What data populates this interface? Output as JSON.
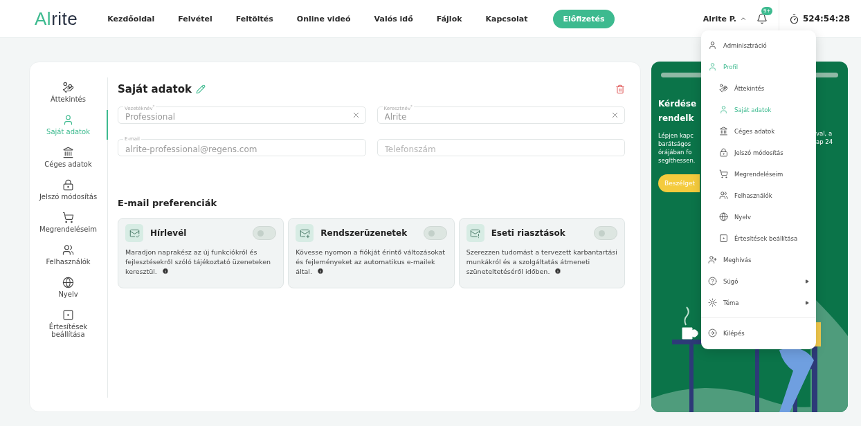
{
  "header": {
    "logo": {
      "accent": "Al",
      "rest": "rite"
    },
    "nav": [
      {
        "label": "Kezdőoldal"
      },
      {
        "label": "Felvétel"
      },
      {
        "label": "Feltöltés"
      },
      {
        "label": "Online videó"
      },
      {
        "label": "Valós idő"
      },
      {
        "label": "Fájlok"
      },
      {
        "label": "Kapcsolat"
      }
    ],
    "subscribe_button": "Előfizetés",
    "user": "Alrite P.",
    "menu_open": true,
    "notification_badge": "9+",
    "timer": "524:54:28"
  },
  "sidebar": {
    "items": [
      {
        "label": "Áttekintés",
        "selected": false
      },
      {
        "label": "Saját adatok",
        "selected": true
      },
      {
        "label": "Céges adatok",
        "selected": false
      },
      {
        "label": "Jelszó módosítás",
        "selected": false
      },
      {
        "label": "Megrendeléseim",
        "selected": false
      },
      {
        "label": "Felhasználók",
        "selected": false
      },
      {
        "label": "Nyelv",
        "selected": false
      },
      {
        "label": "Értesítések beállítása",
        "selected": false
      }
    ]
  },
  "profile": {
    "title": "Saját adatok",
    "fields": [
      {
        "label": "Vezetéknév$^{*}$",
        "value": "Professional",
        "clearable": true
      },
      {
        "label": "Keresztnév$^{*}$",
        "value": "Alrite",
        "clearable": true
      },
      {
        "label": "E-mail",
        "value": "alrite-professional@regens.com",
        "clearable": false
      },
      {
        "placeholder": "Telefonszám",
        "clearable": false
      }
    ]
  },
  "preferences": {
    "title": "E-mail preferenciák",
    "items": [
      {
        "title": "Hírlevél",
        "on": false,
        "description": "Maradjon naprakész az új funkciókról és fejlesztésekről szóló tájékoztató üzeneteken keresztül."
      },
      {
        "title": "Rendszerüzenetek",
        "on": false,
        "description": "Kövesse nyomon a fiókját érintő változásokat és fejleményeket az automatikus e-mailek által."
      },
      {
        "title": "Eseti riasztások",
        "on": false,
        "description": "Szerezzen tudomást a tervezett karbantartási munkákról és a szolgáltatás átmeneti szüneteltetéséről időben."
      }
    ]
  },
  "promo": {
    "title_fragments": [
      "Kérdése",
      "rendelk"
    ],
    "text_fragments_left": [
      "Lépjen kapc",
      "barátságos",
      "órájában fo",
      "segíthessen."
    ],
    "text_fragments_right": [
      "val, a",
      "ap 24"
    ],
    "button": "Beszélget"
  },
  "user_menu": {
    "items": [
      {
        "label": "Adminisztráció",
        "selected": false,
        "kind": "link"
      },
      {
        "label": "Profil",
        "selected": true,
        "kind": "link",
        "children": [
          {
            "label": "Áttekintés",
            "selected": false
          },
          {
            "label": "Saját adatok",
            "selected": true
          },
          {
            "label": "Céges adatok",
            "selected": false
          },
          {
            "label": "Jelszó módosítás",
            "selected": false
          },
          {
            "label": "Megrendeléseim",
            "selected": false
          },
          {
            "label": "Felhasználók",
            "selected": false
          },
          {
            "label": "Nyelv",
            "selected": false
          },
          {
            "label": "Értesítések beállítása",
            "selected": false
          }
        ]
      },
      {
        "label": "Meghívás",
        "selected": false,
        "kind": "link"
      },
      {
        "label": "Súgó",
        "selected": false,
        "kind": "submenu"
      },
      {
        "label": "Téma",
        "selected": false,
        "kind": "submenu"
      }
    ],
    "footer_items": [
      {
        "label": "Kilépés",
        "selected": false
      }
    ]
  }
}
